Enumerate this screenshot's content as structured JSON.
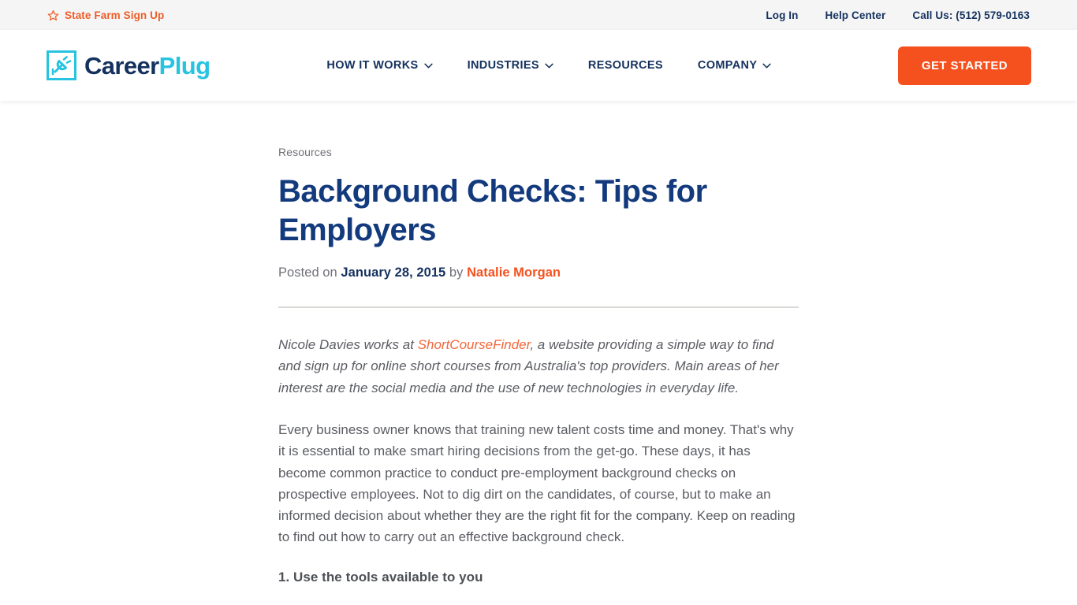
{
  "topbar": {
    "promo": {
      "icon": "star-icon",
      "label": "State Farm Sign Up"
    },
    "links": [
      {
        "name": "log-in",
        "label": "Log In"
      },
      {
        "name": "help-center",
        "label": "Help Center"
      },
      {
        "name": "call-us",
        "label": "Call Us: (512) 579-0163"
      }
    ]
  },
  "header": {
    "logo": {
      "icon": "plug-icon",
      "part1": "Career",
      "part2": "Plug"
    },
    "nav": [
      {
        "name": "how-it-works",
        "label": "HOW IT WORKS",
        "has_dropdown": true
      },
      {
        "name": "industries",
        "label": "INDUSTRIES",
        "has_dropdown": true
      },
      {
        "name": "resources",
        "label": "RESOURCES",
        "has_dropdown": false
      },
      {
        "name": "company",
        "label": "COMPANY",
        "has_dropdown": true
      }
    ],
    "cta_label": "GET STARTED"
  },
  "article": {
    "breadcrumb": "Resources",
    "title": "Background Checks: Tips for Employers",
    "byline": {
      "posted_prefix": "Posted on ",
      "date": "January 28, 2015",
      "by_text": " by ",
      "author": "Natalie Morgan"
    },
    "intro": {
      "before_link": "Nicole Davies works at ",
      "link": "ShortCourseFinder",
      "after_link": ", a website providing a simple way to find and sign up for online short courses from Australia's top providers. Main areas of her interest are the social media and the use of new technologies in everyday life."
    },
    "paragraph_1": "Every business owner knows that training new talent costs time and money. That's why it is essential to make smart hiring decisions from the get-go. These days, it has become common practice to conduct pre-employment background checks on prospective employees. Not to dig dirt on the candidates, of course, but to make an informed decision about whether they are the right fit for the company. Keep on reading to find out how to carry out an effective background check.",
    "subheading_1": "1. Use the tools available to you"
  },
  "colors": {
    "brand_navy": "#14315e",
    "brand_cyan": "#27c3e0",
    "accent_orange": "#f4511e",
    "title_blue": "#133a7d",
    "topbar_bg": "#f5f5f5",
    "body_text": "#5b5d63",
    "divider": "#dbd9d6"
  }
}
